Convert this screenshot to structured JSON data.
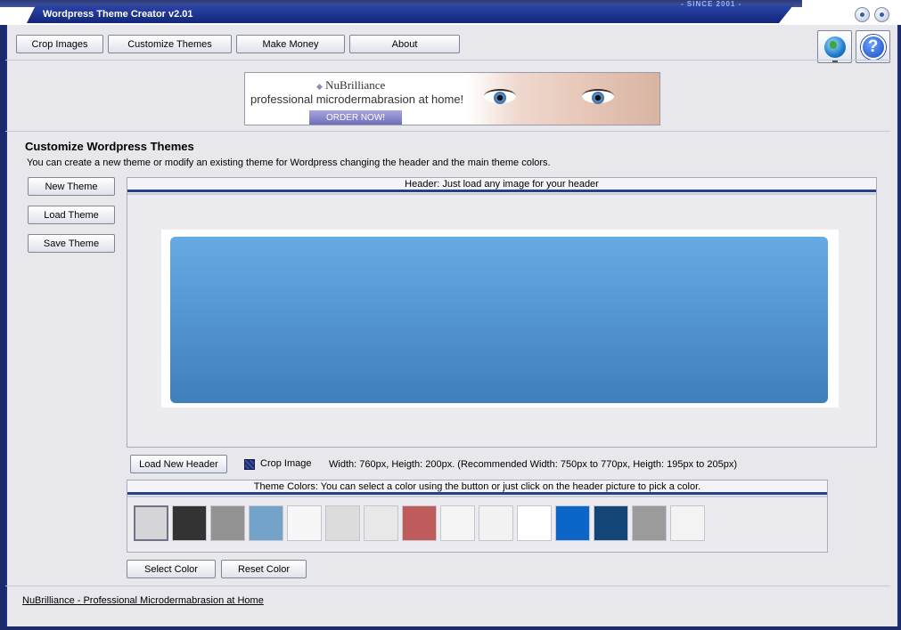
{
  "window": {
    "title": "Wordpress Theme Creator v2.01",
    "since": "- SINCE 2001 -"
  },
  "toolbar": {
    "crop_images": "Crop Images",
    "customize_themes": "Customize Themes",
    "make_money": "Make Money",
    "about": "About",
    "icons": [
      "globe-icon",
      "help-icon"
    ]
  },
  "ad": {
    "brand": "NuBrilliance",
    "tagline": "professional microdermabrasion at home!",
    "cta": "ORDER NOW!"
  },
  "section": {
    "title": "Customize Wordpress Themes",
    "description": "You can create a new theme or modify an existing theme for Wordpress changing the header and the main theme colors."
  },
  "side_buttons": {
    "new_theme": "New Theme",
    "load_theme": "Load Theme",
    "save_theme": "Save Theme"
  },
  "header_panel": {
    "title": "Header: Just load any image for your header"
  },
  "header_controls": {
    "load_new_header": "Load New Header",
    "crop_image": "Crop Image",
    "dimensions": "Width: 760px, Heigth: 200px. (Recommended Width: 750px to 770px, Heigth: 195px to 205px)"
  },
  "colors_panel": {
    "title": "Theme Colors: You can select a color using the button or just click on the header picture to pick a color.",
    "swatches": [
      "#d5d5d8",
      "#333333",
      "#939393",
      "#73a3c8",
      "#f7f7f7",
      "#dcdcdc",
      "#e8e8e8",
      "#bf5b5b",
      "#f5f5f5",
      "#f2f2f2",
      "#ffffff",
      "#0c66c8",
      "#134577",
      "#9b9b9b",
      "#f3f3f3"
    ]
  },
  "color_buttons": {
    "select_color": "Select Color",
    "reset_color": "Reset Color"
  },
  "footer": {
    "link": "NuBrilliance - Professional Microdermabrasion at Home"
  }
}
